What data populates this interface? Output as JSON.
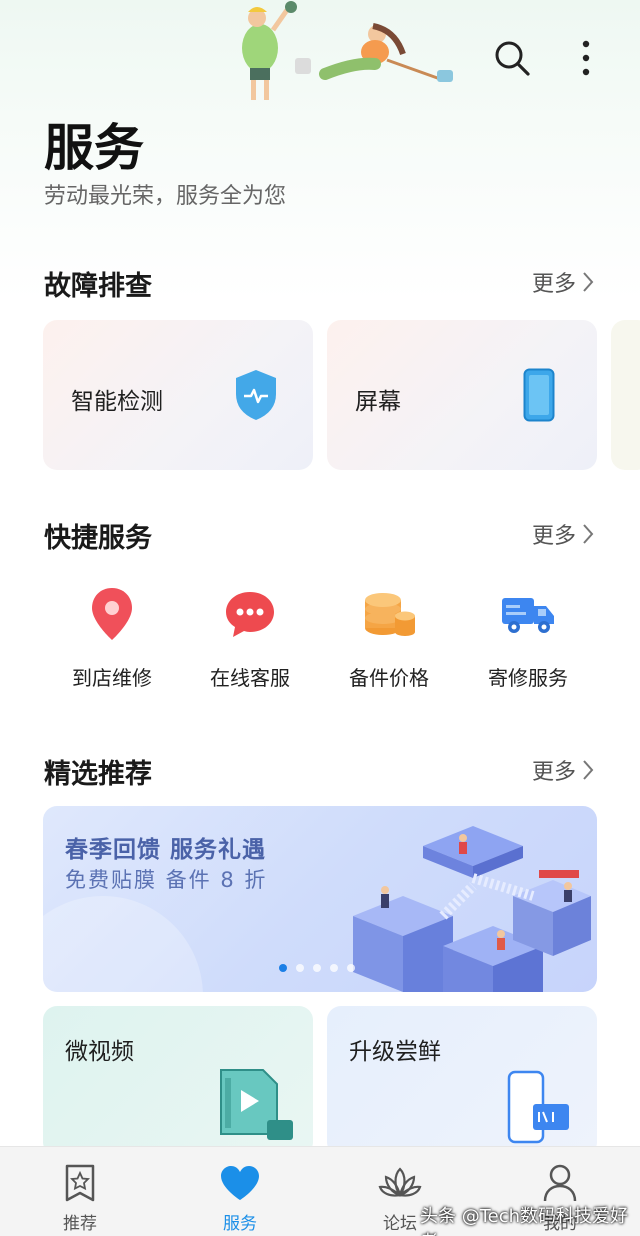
{
  "header": {
    "title": "服务",
    "subtitle": "劳动最光荣，服务全为您"
  },
  "troubleshoot": {
    "title": "故障排查",
    "more_label": "更多",
    "cards": [
      {
        "label": "智能检测",
        "icon": "shield-icon"
      },
      {
        "label": "屏幕",
        "icon": "phone-screen-icon"
      }
    ]
  },
  "quick_services": {
    "title": "快捷服务",
    "more_label": "更多",
    "items": [
      {
        "label": "到店维修",
        "icon": "location-pin-icon"
      },
      {
        "label": "在线客服",
        "icon": "chat-bubble-icon"
      },
      {
        "label": "备件价格",
        "icon": "coins-icon"
      },
      {
        "label": "寄修服务",
        "icon": "delivery-truck-icon"
      }
    ]
  },
  "featured": {
    "title": "精选推荐",
    "more_label": "更多",
    "banner": {
      "title": "春季回馈  服务礼遇",
      "subtitle": "免费贴膜  备件 8 折",
      "active_dot": 0,
      "dot_count": 5
    },
    "cards": [
      {
        "label": "微视频",
        "icon": "video-file-icon"
      },
      {
        "label": "升级尝鲜",
        "icon": "phone-upgrade-icon"
      }
    ]
  },
  "bottom_nav": {
    "items": [
      {
        "label": "推荐",
        "icon": "star-bookmark-icon",
        "active": false
      },
      {
        "label": "服务",
        "icon": "heart-icon",
        "active": true
      },
      {
        "label": "论坛",
        "icon": "lotus-icon",
        "active": false
      },
      {
        "label": "我的",
        "icon": "person-icon",
        "active": false
      }
    ]
  },
  "watermark": "头条 @Tech数码科技爱好者",
  "colors": {
    "accent_blue": "#1b8fe8",
    "pin_red": "#f0505a",
    "coin_orange": "#f5a03c",
    "truck_blue": "#3d86f0",
    "banner_text": "#4a62a8"
  }
}
